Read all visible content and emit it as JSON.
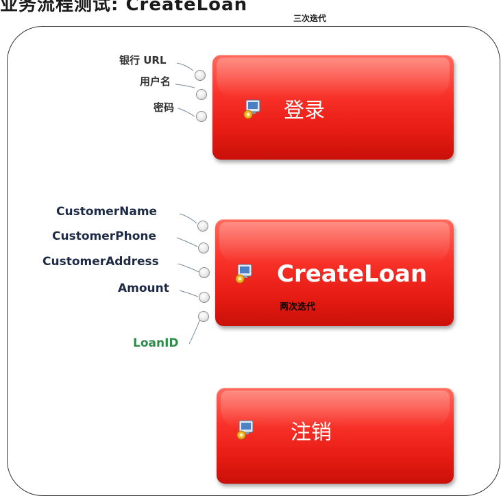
{
  "header": {
    "title": "业务流程测试: CreateLoan"
  },
  "outer_note": "三次迭代",
  "steps": {
    "login": {
      "label": "登录",
      "params": [
        "银行 URL",
        "用户名",
        "密码"
      ]
    },
    "create": {
      "label": "CreateLoan",
      "note": "两次迭代",
      "params": [
        "CustomerName",
        "CustomerPhone",
        "CustomerAddress",
        "Amount"
      ],
      "output": "LoanID"
    },
    "logout": {
      "label": "注销"
    }
  },
  "colors": {
    "step_fill": "#f8322a",
    "param_text": "#1e2a44",
    "output_text": "#2e8b4a"
  },
  "icon": "component-icon"
}
